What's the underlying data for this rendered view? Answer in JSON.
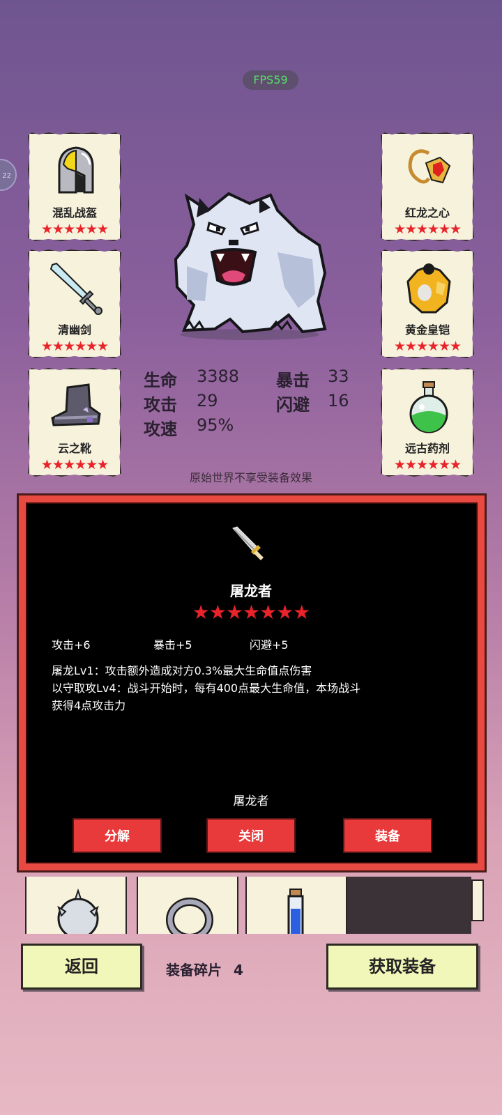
{
  "status": {
    "fps": "FPS59",
    "side_tab": "22"
  },
  "equipment": {
    "helmet": {
      "name": "混乱战盔",
      "stars": "★★★★★★"
    },
    "sword": {
      "name": "清幽剑",
      "stars": "★★★★★★"
    },
    "boots": {
      "name": "云之靴",
      "stars": "★★★★★★"
    },
    "amulet": {
      "name": "红龙之心",
      "stars": "★★★★★★"
    },
    "armor": {
      "name": "黄金皇铠",
      "stars": "★★★★★★"
    },
    "potion": {
      "name": "远古药剂",
      "stars": "★★★★★★"
    }
  },
  "stats": {
    "hp": {
      "label": "生命",
      "value": "3388"
    },
    "attack": {
      "label": "攻击",
      "value": "29"
    },
    "attack_speed": {
      "label": "攻速",
      "value": "95%"
    },
    "crit": {
      "label": "暴击",
      "value": "33"
    },
    "dodge": {
      "label": "闪避",
      "value": "16"
    }
  },
  "note": "原始世界不享受装备效果",
  "dialog": {
    "title": "屠龙者",
    "stars": "★★★★★★★",
    "attrs": [
      "攻击+6",
      "暴击+5",
      "闪避+5"
    ],
    "desc": [
      "屠龙Lv1：攻击额外造成对方0.3%最大生命值点伤害",
      "以守取攻Lv4：战斗开始时，每有400点最大生命值，本场战斗",
      "获得4点攻击力"
    ],
    "footer": "屠龙者",
    "buttons": {
      "decompose": "分解",
      "close": "关闭",
      "equip": "装备"
    }
  },
  "bottom": {
    "back": "返回",
    "fragments_label": "装备碎片",
    "fragments_count": "4",
    "get_equipment": "获取装备"
  },
  "colors": {
    "star_red": "#e8232a",
    "dialog_border": "#e84a42",
    "button_red": "#e8393b",
    "button_yellow": "#f1f7b8",
    "fps_green": "#57e06a"
  }
}
